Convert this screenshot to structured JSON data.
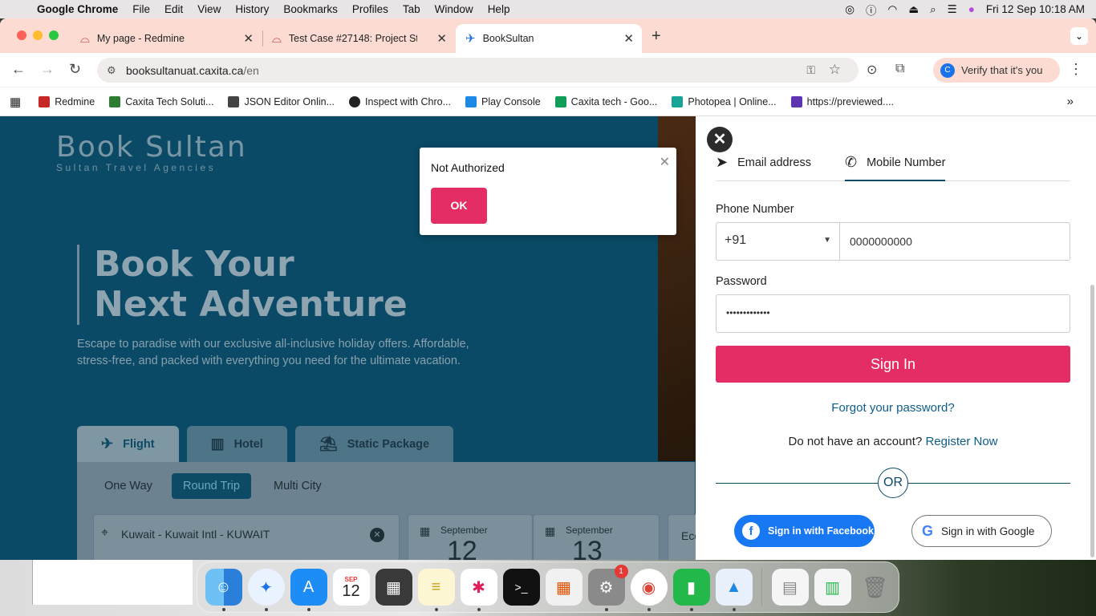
{
  "menubar": {
    "app": "Google Chrome",
    "items": [
      "File",
      "Edit",
      "View",
      "History",
      "Bookmarks",
      "Profiles",
      "Tab",
      "Window",
      "Help"
    ],
    "datetime": "Fri 12 Sep  10:18 AM"
  },
  "tabs": [
    {
      "title": "My page - Redmine"
    },
    {
      "title": "Test Case #27148: Project Stu"
    },
    {
      "title": "BookSultan"
    }
  ],
  "toolbar": {
    "url_host": "booksultanuat.caxita.ca",
    "url_path": "/en",
    "verify_label": "Verify that it's you"
  },
  "bookmarks": [
    {
      "label": "Redmine",
      "color": "#c62828"
    },
    {
      "label": "Caxita Tech Soluti...",
      "color": "#2e7d32"
    },
    {
      "label": "JSON Editor Onlin...",
      "color": "#444444"
    },
    {
      "label": "Inspect with Chro...",
      "color": "#222222"
    },
    {
      "label": "Play Console",
      "color": "#1e88e5"
    },
    {
      "label": "Caxita tech - Goo...",
      "color": "#0f9d58"
    },
    {
      "label": "Photopea | Online...",
      "color": "#18a497"
    },
    {
      "label": "https://previewed....",
      "color": "#5e35b1"
    }
  ],
  "hero": {
    "logo_main": "Book Sultan",
    "logo_sub": "Sultan Travel Agencies",
    "headline_1": "Book Your",
    "headline_2": "Next Adventure",
    "subtitle": "Escape to paradise with our exclusive all-inclusive holiday offers. Affordable, stress-free, and packed with everything you need for the ultimate vacation."
  },
  "search": {
    "tabs": [
      "Flight",
      "Hotel",
      "Static Package"
    ],
    "trip_types": [
      "One Way",
      "Round Trip",
      "Multi City"
    ],
    "from": "Kuwait - Kuwait Intl - KUWAIT",
    "depart_month": "September",
    "depart_day": "12",
    "return_month": "September",
    "return_day": "13",
    "cabin_partial": "Eco"
  },
  "modal": {
    "message": "Not Authorized",
    "ok_label": "OK"
  },
  "login": {
    "tab_email": "Email address",
    "tab_mobile": "Mobile Number",
    "phone_label": "Phone Number",
    "country_code": "+91",
    "phone_value": "0000000000",
    "password_label": "Password",
    "password_value": "•••••••••••••",
    "signin_label": "Sign In",
    "forgot_label": "Forgot your password?",
    "no_account": "Do not have an account?",
    "register_label": "Register Now",
    "or_label": "OR",
    "facebook_label": "Sign in with Facebook",
    "google_label": "Sign in with Google"
  },
  "dock": {
    "calendar_month": "SEP",
    "calendar_day": "12",
    "settings_badge": "1"
  }
}
